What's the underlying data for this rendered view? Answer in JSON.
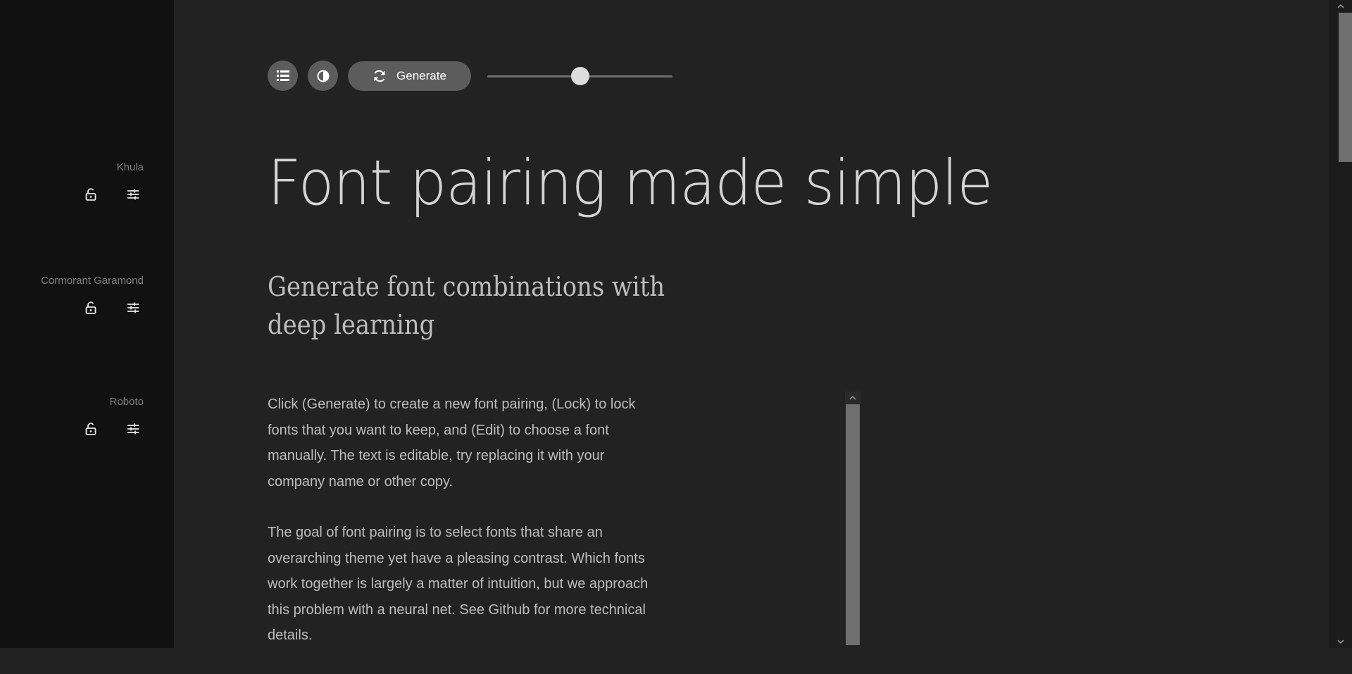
{
  "sidebar": {
    "fonts": [
      {
        "name": "Khula",
        "lock_icon": "unlock-icon",
        "edit_icon": "sliders-icon"
      },
      {
        "name": "Cormorant Garamond",
        "lock_icon": "unlock-icon",
        "edit_icon": "sliders-icon"
      },
      {
        "name": "Roboto",
        "lock_icon": "unlock-icon",
        "edit_icon": "sliders-icon"
      }
    ]
  },
  "toolbar": {
    "list_icon": "list-icon",
    "contrast_icon": "contrast-icon",
    "generate_icon": "refresh-icon",
    "generate_label": "Generate",
    "slider_value": 0.5
  },
  "main": {
    "headline": "Font pairing made simple",
    "subhead": "Generate font combinations with deep learning",
    "paragraphs": [
      "Click (Generate) to create a new font pairing, (Lock) to lock fonts that you want to keep, and (Edit) to choose a font manually. The text is editable, try replacing it with your company name or other copy.",
      "The goal of font pairing is to select fonts that share an overarching theme yet have a pleasing contrast. Which fonts work together is largely a matter of intuition, but we approach this problem with a neural net. See Github for more technical details."
    ]
  },
  "colors": {
    "sidebar_bg": "#111111",
    "main_bg": "#222222",
    "button_bg": "#5c5c5c",
    "text": "#bdbdbd"
  }
}
